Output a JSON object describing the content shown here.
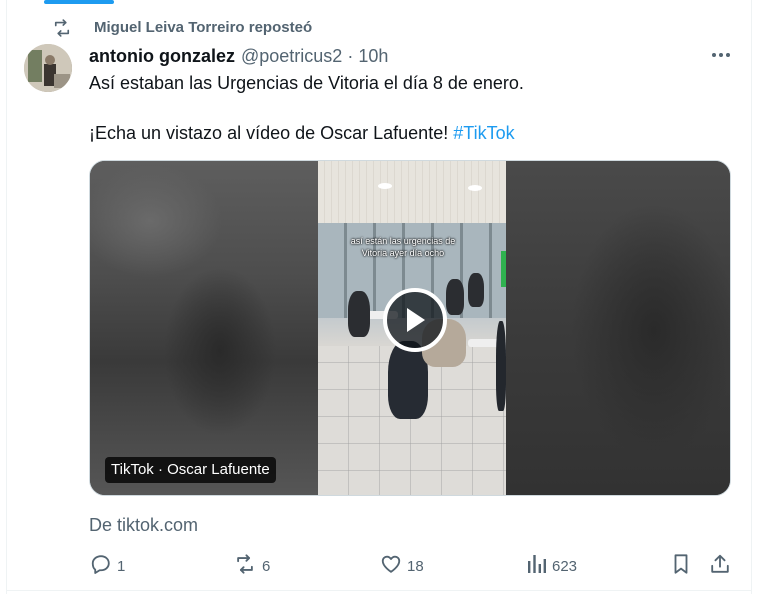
{
  "repost": {
    "icon": "repost-icon",
    "text": "Miguel Leiva Torreiro reposteó"
  },
  "tweet": {
    "author_name": "antonio gonzalez",
    "handle": "@poetricus2",
    "separator": "·",
    "time": "10h",
    "text_line1": "Así estaban las Urgencias de Vitoria el día 8 de enero.",
    "text_line2_prefix": "¡Echa un vistazo al vídeo de Oscar Lafuente!",
    "hashtag": "#TikTok",
    "media": {
      "overlay_text": "así están las urgencias de Vitoria ayer día ocho",
      "badge": "TikTok · Oscar Lafuente"
    },
    "source": "De tiktok.com"
  },
  "actions": {
    "replies": "1",
    "reposts": "6",
    "likes": "18",
    "views": "623"
  },
  "colors": {
    "accent": "#1d9bf0",
    "secondary_text": "#536471",
    "primary_text": "#0f1419",
    "border": "#cfd9de"
  }
}
